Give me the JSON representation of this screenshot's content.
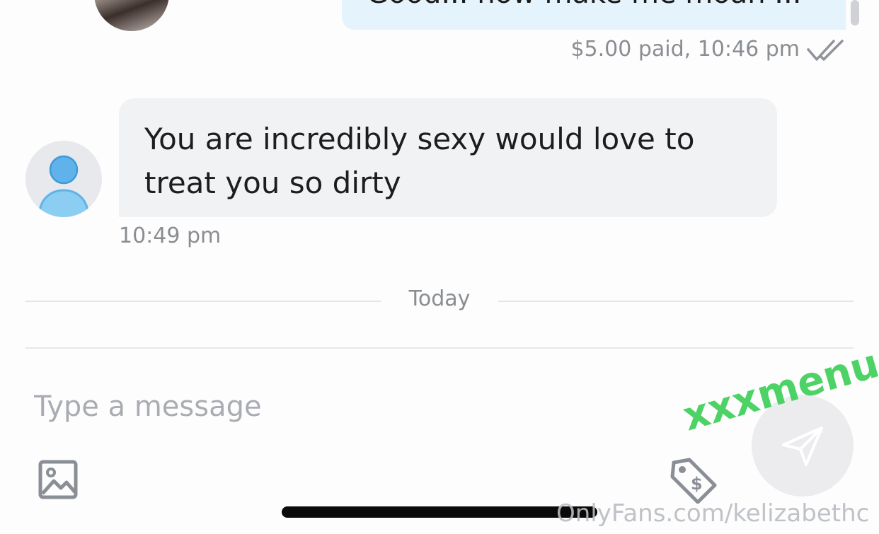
{
  "outgoing": {
    "text": "Good... now make me moan ...",
    "meta": "$5.00 paid, 10:46 pm",
    "status_icon": "double-check-icon"
  },
  "incoming": {
    "text": "You are incredibly sexy would love to treat you so dirty",
    "time": "10:49 pm",
    "avatar_icon": "default-user-icon"
  },
  "divider": {
    "label": "Today"
  },
  "composer": {
    "placeholder": "Type a message",
    "media_icon": "image-icon",
    "price_icon": "price-tag-icon",
    "send_icon": "send-icon"
  },
  "watermark": {
    "site": "xxxmenu.com",
    "url": "OnlyFans.com/kelizabethc"
  },
  "colors": {
    "outgoing_bubble": "#e4f3fc",
    "incoming_bubble": "#f1f2f4",
    "avatar_blue": "#5fb3ea",
    "watermark_green": "#3fcf5a"
  }
}
